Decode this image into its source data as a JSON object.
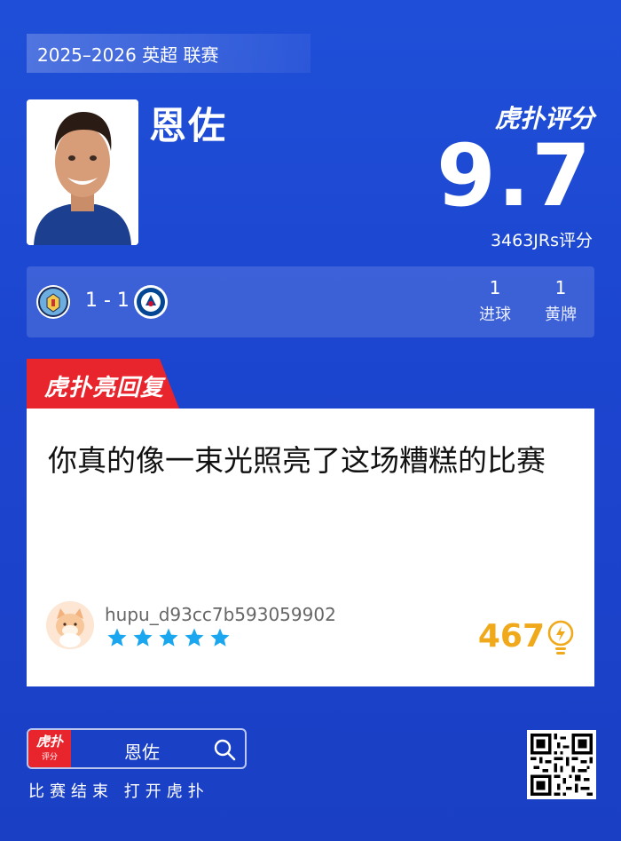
{
  "header": {
    "season": "2025–2026 英超 联赛"
  },
  "player": {
    "name": "恩佐",
    "avatar_icon": "player-photo-icon"
  },
  "rating": {
    "brand": "虎扑评分",
    "score": "9.7",
    "raters": "3463JRs评分"
  },
  "match": {
    "home_logo_icon": "manchester-city-crest-icon",
    "away_logo_icon": "chelsea-crest-icon",
    "score": "1 - 1",
    "stats": [
      {
        "value": "1",
        "label": "进球"
      },
      {
        "value": "1",
        "label": "黄牌"
      }
    ]
  },
  "tag": {
    "text": "虎扑亮回复"
  },
  "reply": {
    "text": "你真的像一束光照亮了这场糟糕的比赛",
    "username": "hupu_d93cc7b593059902",
    "stars": 5,
    "likes": "467",
    "like_icon": "lightbulb-icon"
  },
  "footer": {
    "logo_text": "虎扑",
    "logo_sub": "评分",
    "search_text": "恩佐",
    "cta": "比赛结束 打开虎扑",
    "qr_icon": "qr-code-icon"
  },
  "colors": {
    "background": "#1f4fd8",
    "accent_red": "#e8252c",
    "likes_orange": "#f0a91a",
    "star_blue": "#1aa7f0"
  }
}
